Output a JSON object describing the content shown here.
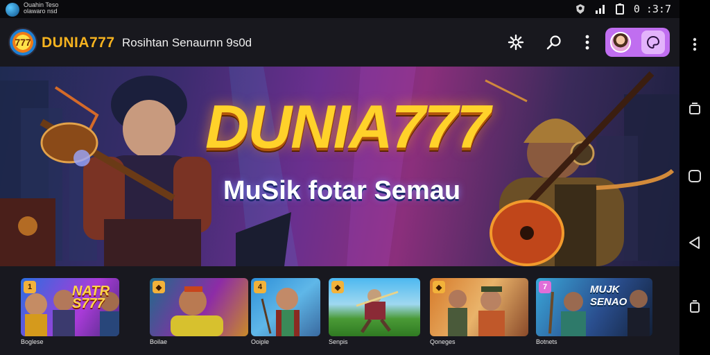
{
  "status_bar": {
    "app_caption": "Ouahin Teso\nolawaro nsd",
    "time": "0 :3:7"
  },
  "header": {
    "brand_mark": "777",
    "brand_name": "DUNIA777",
    "title": "Rosihtan Senaurnn 9s0d"
  },
  "banner": {
    "title": "DUNIA777",
    "subtitle": "MuSik fotar Semau"
  },
  "games": [
    {
      "label": "Boglese",
      "caption": "NATR S777",
      "tag": "1"
    },
    {
      "label": "Boilae",
      "caption": "",
      "tag": "◆"
    },
    {
      "label": "Ooiple",
      "caption": "",
      "tag": "4"
    },
    {
      "label": "Senpis",
      "caption": "",
      "tag": "◆"
    },
    {
      "label": "Qoneges",
      "caption": "",
      "tag": "◆"
    },
    {
      "label": "Botnets",
      "caption": "MUJK SENAO",
      "tag": "7"
    }
  ],
  "colors": {
    "accent": "#f6b31f",
    "profile_pill": "#c06ef0",
    "background": "#14141a"
  },
  "icons": {
    "settings": "gear-icon",
    "search": "search-icon",
    "menu": "more-vertical-icon"
  }
}
